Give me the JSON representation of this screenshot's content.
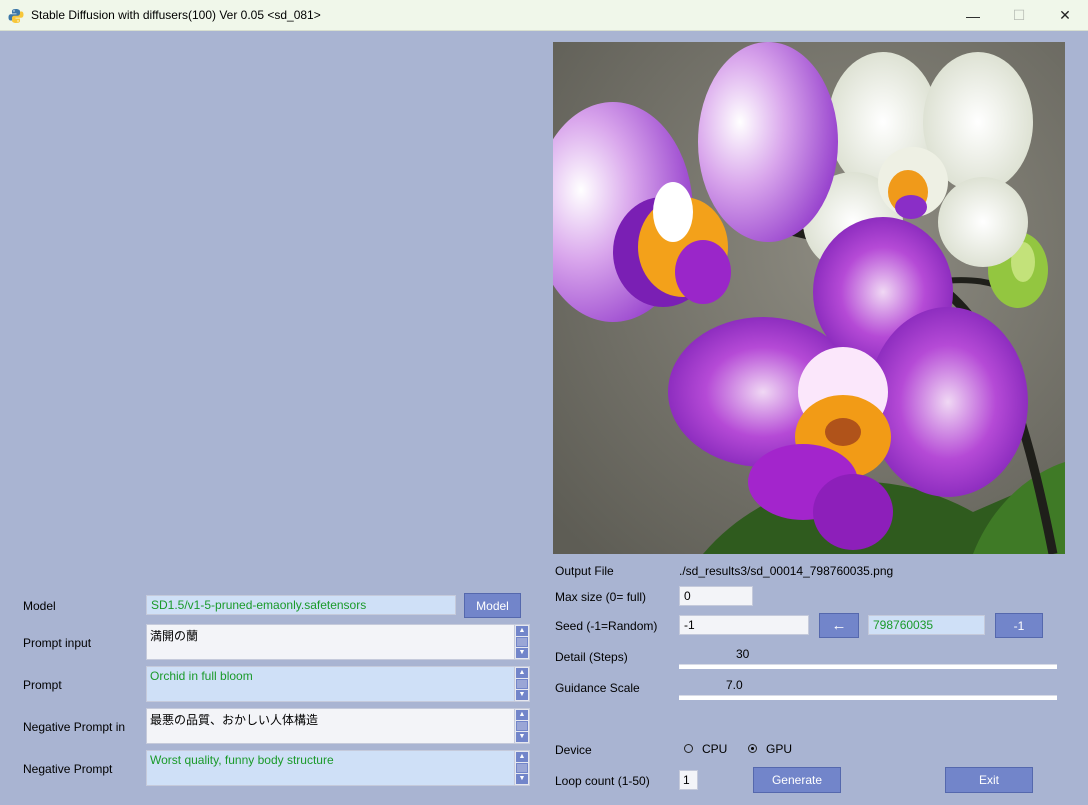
{
  "window": {
    "title": "Stable Diffusion with diffusers(100)  Ver 0.05 <sd_081>",
    "minimize": "—",
    "maximize": "☐",
    "close": "✕"
  },
  "output_file": {
    "label": "Output File",
    "value": "./sd_results3/sd_00014_798760035.png"
  },
  "max_size": {
    "label": "Max size (0= full)",
    "value": "0"
  },
  "seed": {
    "label": "Seed  (-1=Random)",
    "value": "-1",
    "arrow_button": "←",
    "last_seed": "798760035",
    "reset_button": "-1"
  },
  "steps": {
    "label": "Detail (Steps)",
    "value": "30",
    "level": 0.2
  },
  "guidance": {
    "label": "Guidance Scale",
    "value": "7.0",
    "level": 0.15
  },
  "device": {
    "label": "Device",
    "options": [
      "CPU",
      "GPU"
    ],
    "selected": "GPU"
  },
  "loop": {
    "label": "Loop count (1-50)",
    "value": "1"
  },
  "buttons": {
    "generate": "Generate",
    "exit": "Exit"
  },
  "model": {
    "label": "Model",
    "value": "SD1.5/v1-5-pruned-emaonly.safetensors",
    "button": "Model"
  },
  "prompt_input": {
    "label": "Prompt input",
    "value": "満開の蘭"
  },
  "prompt": {
    "label": "Prompt",
    "value": "Orchid in full bloom"
  },
  "negative_prompt_input": {
    "label": "Negative Prompt in",
    "value": "最悪の品質、おかしい人体構造"
  },
  "negative_prompt": {
    "label": "Negative Prompt",
    "value": "Worst quality, funny body structure"
  },
  "colors": {
    "background": "#a9b4d2",
    "button": "#7285ca",
    "green_text": "#1a9a2a",
    "field_blue": "#cfe0f7"
  }
}
